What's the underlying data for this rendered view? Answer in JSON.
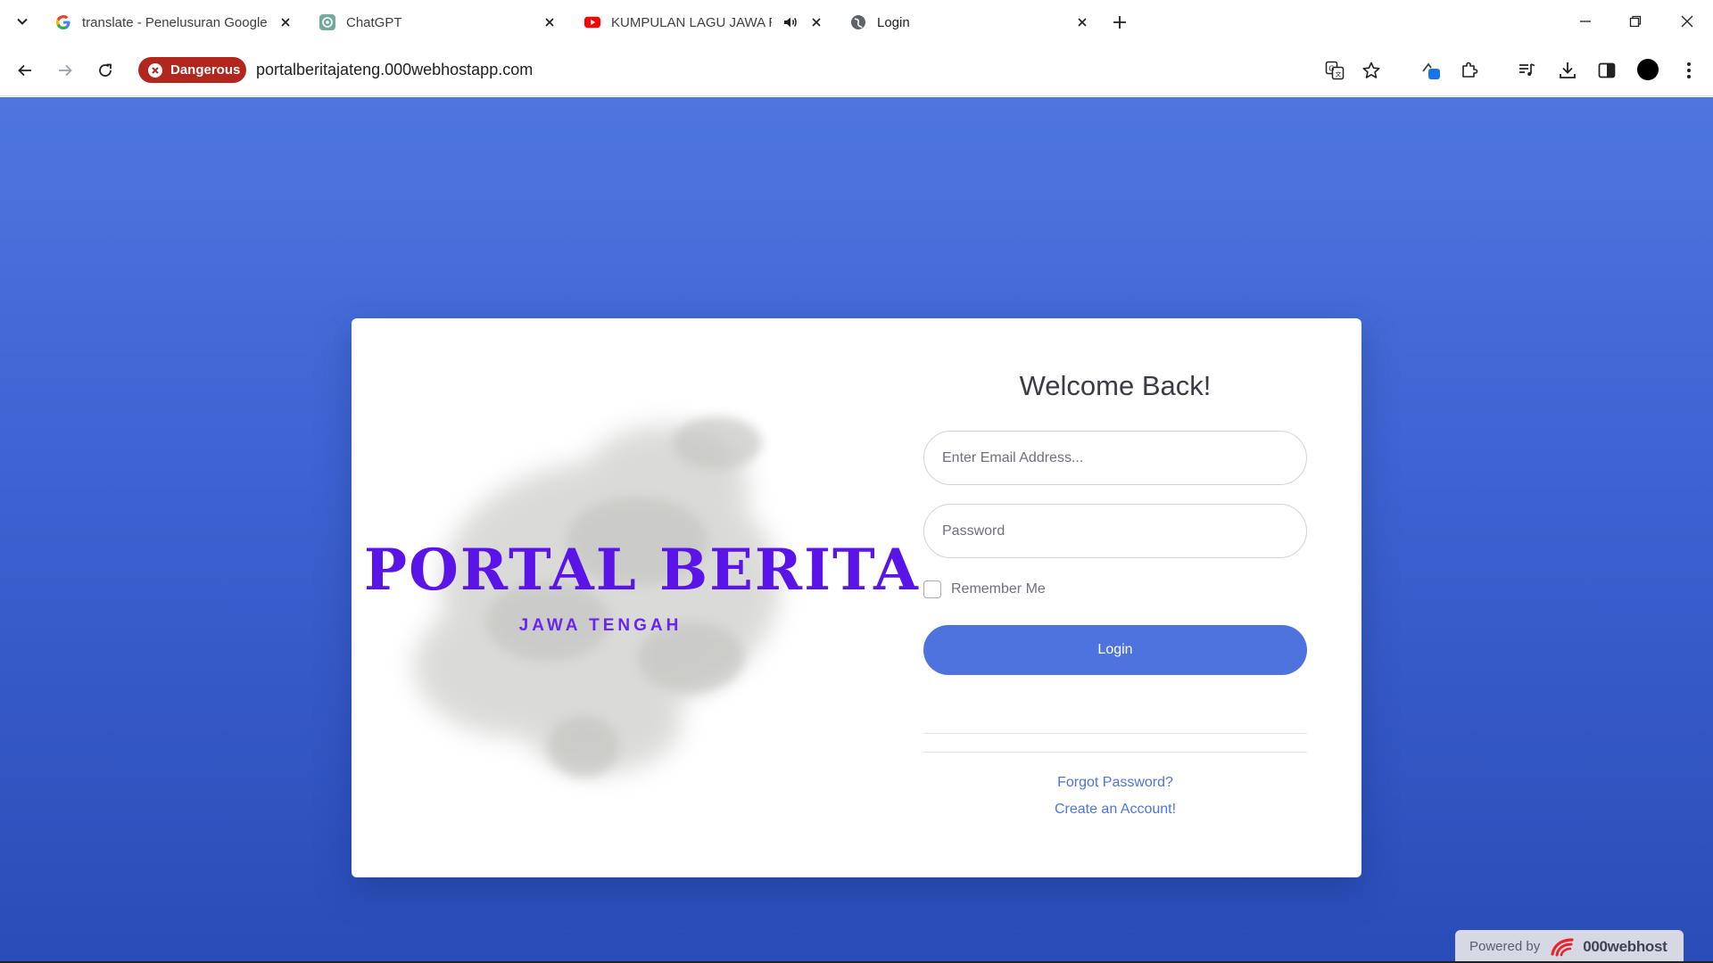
{
  "browser": {
    "tabs": [
      {
        "title": "translate - Penelusuran Google",
        "favicon": "google-icon"
      },
      {
        "title": "ChatGPT",
        "favicon": "chatgpt-icon"
      },
      {
        "title": "KUMPULAN LAGU JAWA RE",
        "favicon": "youtube-icon",
        "audio": true
      },
      {
        "title": "Login",
        "favicon": "globe-icon",
        "active": true
      }
    ],
    "security_label": "Dangerous",
    "url": "portalberitajateng.000webhostapp.com",
    "colors": {
      "danger": "#b3261e",
      "accent": "#1a73e8"
    }
  },
  "page": {
    "brand_title": "PORTAL BERITA",
    "brand_subtitle": "JAWA TENGAH",
    "welcome": "Welcome Back!",
    "email_placeholder": "Enter Email Address...",
    "password_placeholder": "Password",
    "remember_label": "Remember Me",
    "login_label": "Login",
    "forgot_label": "Forgot Password?",
    "create_label": "Create an Account!",
    "colors": {
      "background": "#4e73df",
      "brand": "#5b14e8",
      "link": "#4e73df"
    }
  },
  "badge": {
    "powered_label": "Powered by",
    "host_name": "000webhost"
  }
}
